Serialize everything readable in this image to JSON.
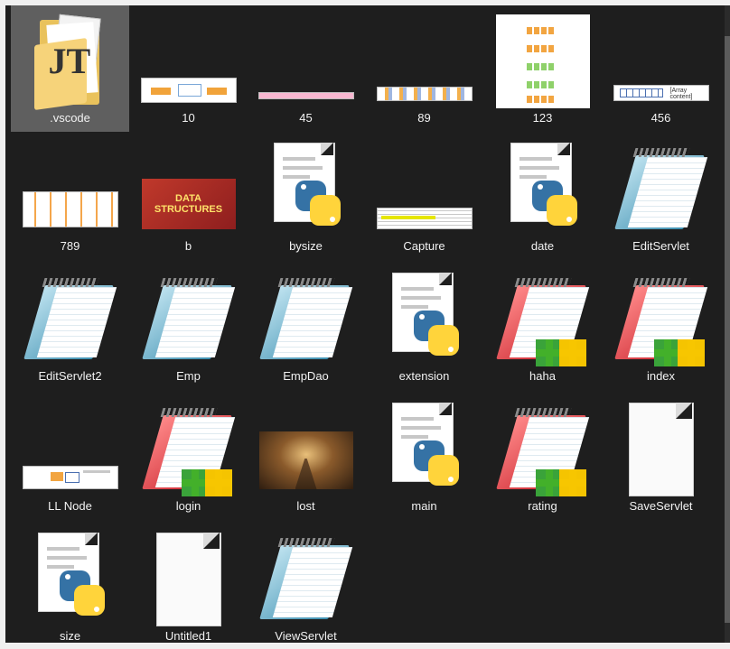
{
  "files": [
    {
      "name": ".vscode",
      "icon": "folder-icon",
      "selected": true
    },
    {
      "name": "10",
      "icon": "image-thumbnail-icon"
    },
    {
      "name": "45",
      "icon": "image-thumbnail-icon"
    },
    {
      "name": "89",
      "icon": "image-thumbnail-icon"
    },
    {
      "name": "123",
      "icon": "image-thumbnail-icon"
    },
    {
      "name": "456",
      "icon": "image-thumbnail-icon",
      "thumb_text": "[Array content]"
    },
    {
      "name": "789",
      "icon": "image-thumbnail-icon"
    },
    {
      "name": "b",
      "icon": "image-thumbnail-icon",
      "thumb_text": "DATA STRUCTURES"
    },
    {
      "name": "bysize",
      "icon": "python-file-icon"
    },
    {
      "name": "Capture",
      "icon": "image-thumbnail-icon"
    },
    {
      "name": "date",
      "icon": "python-file-icon"
    },
    {
      "name": "EditServlet",
      "icon": "notepad-icon"
    },
    {
      "name": "EditServlet2",
      "icon": "notepad-icon"
    },
    {
      "name": "Emp",
      "icon": "notepad-icon"
    },
    {
      "name": "EmpDao",
      "icon": "notepad-icon"
    },
    {
      "name": "extension",
      "icon": "python-file-icon"
    },
    {
      "name": "haha",
      "icon": "notepad-plus-plus-icon"
    },
    {
      "name": "index",
      "icon": "notepad-plus-plus-icon"
    },
    {
      "name": "LL Node",
      "icon": "image-thumbnail-icon"
    },
    {
      "name": "login",
      "icon": "notepad-plus-plus-icon"
    },
    {
      "name": "lost",
      "icon": "photo-thumbnail-icon"
    },
    {
      "name": "main",
      "icon": "python-file-icon"
    },
    {
      "name": "rating",
      "icon": "notepad-plus-plus-icon"
    },
    {
      "name": "SaveServlet",
      "icon": "blank-document-icon"
    },
    {
      "name": "size",
      "icon": "python-file-icon"
    },
    {
      "name": "Untitled1",
      "icon": "blank-document-icon"
    },
    {
      "name": "ViewServlet",
      "icon": "notepad-icon"
    }
  ]
}
